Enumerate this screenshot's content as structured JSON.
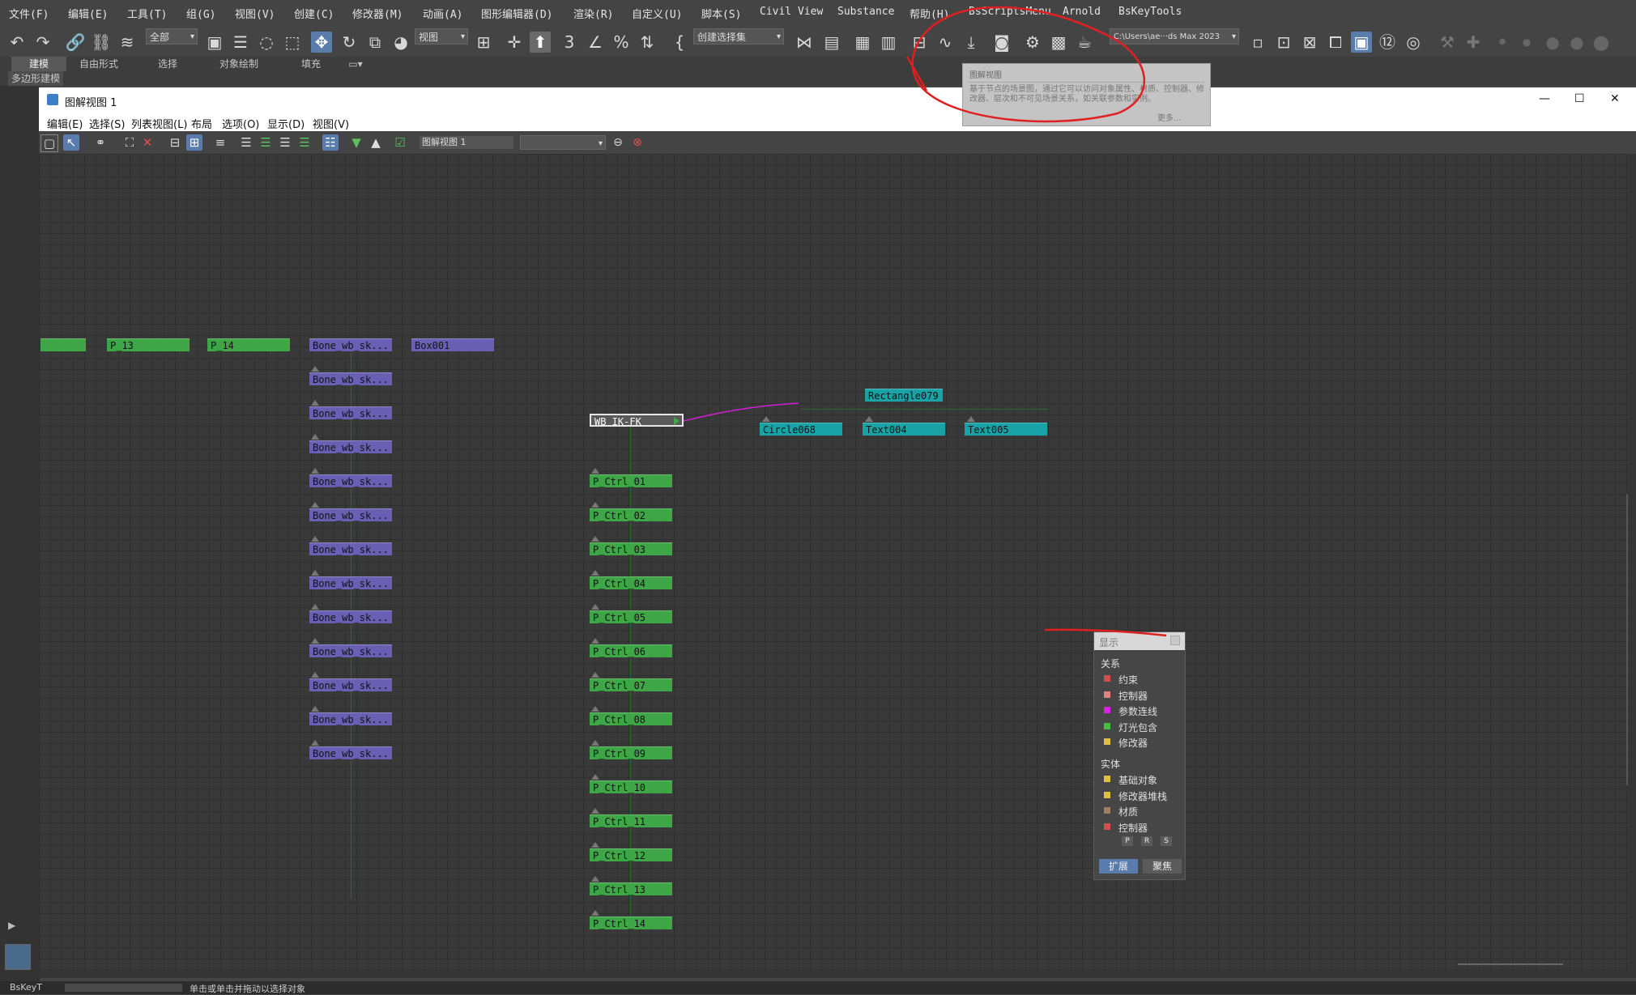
{
  "menu": [
    "文件(F)",
    "编辑(E)",
    "工具(T)",
    "组(G)",
    "视图(V)",
    "创建(C)",
    "修改器(M)",
    "动画(A)",
    "图形编辑器(D)",
    "渲染(R)",
    "自定义(U)",
    "脚本(S)",
    "Civil View",
    "Substance",
    "帮助(H)",
    "BsScriptsMenu",
    "Arnold",
    "BsKeyTools"
  ],
  "toolbar": {
    "selection_filter": "全部",
    "ref_coord": "视图",
    "named_selection": "创建选择集",
    "project_path": "C:\\Users\\ae···ds Max 2023"
  },
  "ribbon": {
    "tabs": [
      "建模",
      "自由形式",
      "选择",
      "对象绘制",
      "填充"
    ],
    "subtab": "多边形建模"
  },
  "schematic": {
    "title": "图解视图 1",
    "menu": [
      "编辑(E)",
      "选择(S)",
      "列表视图(L)",
      "布局",
      "选项(O)",
      "显示(D)",
      "视图(V)"
    ],
    "view_name": "图解视图 1",
    "window_controls": {
      "minimize": "—",
      "maximize": "☐",
      "close": "✕"
    }
  },
  "nodes": {
    "top_row": [
      "",
      "P_13",
      "P_14",
      "Bone_wb_sk...",
      "Box001"
    ],
    "bones": [
      "Bone_wb_sk...",
      "Bone_wb_sk...",
      "Bone_wb_sk...",
      "Bone_wb_sk...",
      "Bone_wb_sk...",
      "Bone_wb_sk...",
      "Bone_wb_sk...",
      "Bone_wb_sk...",
      "Bone_wb_sk...",
      "Bone_wb_sk...",
      "Bone_wb_sk...",
      "Bone_wb_sk..."
    ],
    "ikfk": "WB_IK-FK",
    "ctrls": [
      "P_Ctrl_01",
      "P_Ctrl_02",
      "P_Ctrl_03",
      "P_Ctrl_04",
      "P_Ctrl_05",
      "P_Ctrl_06",
      "P_Ctrl_07",
      "P_Ctrl_08",
      "P_Ctrl_09",
      "P_Ctrl_10",
      "P_Ctrl_11",
      "P_Ctrl_12",
      "P_Ctrl_13",
      "P_Ctrl_14"
    ],
    "rect": "Rectangle079",
    "shapes": [
      "Circle068",
      "Text004",
      "Text005"
    ]
  },
  "display_panel": {
    "title": "显示",
    "relations_header": "关系",
    "relations": [
      {
        "label": "约束",
        "color": "#d05050"
      },
      {
        "label": "控制器",
        "color": "#e08080"
      },
      {
        "label": "参数连线",
        "color": "#e020e0"
      },
      {
        "label": "灯光包含",
        "color": "#40c040"
      },
      {
        "label": "修改器",
        "color": "#e0c040"
      }
    ],
    "entities_header": "实体",
    "entities": [
      {
        "label": "基础对象",
        "color": "#e0c040"
      },
      {
        "label": "修改器堆栈",
        "color": "#e0c040"
      },
      {
        "label": "材质",
        "color": "#a08060"
      },
      {
        "label": "控制器",
        "color": "#d05050"
      }
    ],
    "prs": [
      "P",
      "R",
      "S"
    ],
    "expand": "扩展",
    "focus": "聚焦"
  },
  "tooltip": {
    "title": "图解视图",
    "body": "基于节点的场景图，通过它可以访问对象属性、材质、控制器、修改器、层次和不可见场景关系，如关联参数和实例。",
    "more": "更多..."
  },
  "status": {
    "left": "BsKeyT",
    "message": "单击或单击并拖动以选择对象"
  }
}
